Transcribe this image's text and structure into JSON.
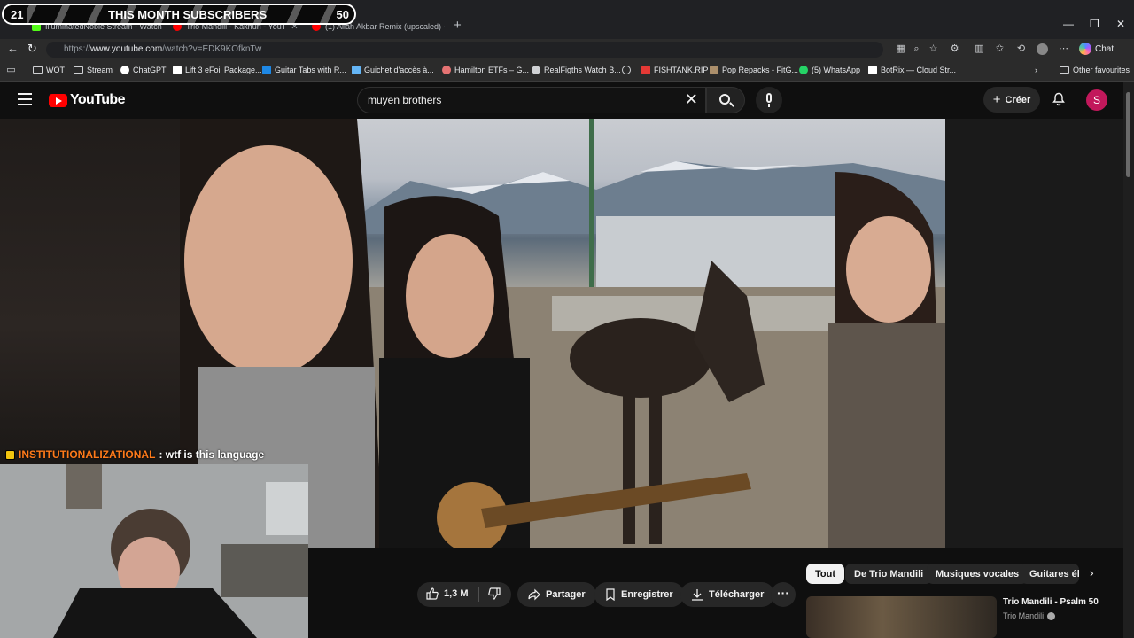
{
  "overlay": {
    "left_count": "21",
    "title": "THIS MONTH SUBSCRIBERS",
    "right_count": "50"
  },
  "tabs": [
    {
      "label": "IlluminatedNoble Stream - Watch",
      "color": "#53fc18"
    },
    {
      "label": "Trio Mandili - Kakhuri - YouT",
      "color": "#ff0000"
    },
    {
      "label": "(1) Allah Akbar Remix (upscaled) -",
      "color": "#ff0000"
    }
  ],
  "browser": {
    "url_prefix": "https://",
    "url_host": "www.youtube.com",
    "url_path": "/watch?v=EDK9KOfknTw",
    "chat_label": "Chat"
  },
  "bookmarks": [
    {
      "label": "WOT",
      "icon": "folder-icon"
    },
    {
      "label": "Stream",
      "icon": "folder-icon"
    },
    {
      "label": "ChatGPT",
      "icon": "chatgpt-icon",
      "color": "#ffffff"
    },
    {
      "label": "Lift 3 eFoil Package...",
      "icon": "lift-icon",
      "color": "#ffffff"
    },
    {
      "label": "Guitar Tabs with R...",
      "icon": "tabs-icon",
      "color": "#1e88e5"
    },
    {
      "label": "Guichet d'accès à...",
      "icon": "guichet-icon",
      "color": "#64b5f6"
    },
    {
      "label": "Hamilton ETFs – G...",
      "icon": "hamilton-icon",
      "color": "#e57373"
    },
    {
      "label": "RealFigths Watch B...",
      "icon": "wordpress-icon",
      "color": "#cfd1d4"
    },
    {
      "label": "",
      "icon": "globe-icon",
      "color": "#cfd1d4"
    },
    {
      "label": "FISHTANK.RIP",
      "icon": "fishtank-icon",
      "color": "#e53935"
    },
    {
      "label": "Pop Repacks - FitG...",
      "icon": "fitgirl-icon",
      "color": "#ab8f6b"
    },
    {
      "label": "(5) WhatsApp",
      "icon": "whatsapp-icon",
      "color": "#25d366"
    },
    {
      "label": "BotRix — Cloud Str...",
      "icon": "botrix-icon",
      "color": "#ffffff"
    }
  ],
  "other_favourites": "Other favourites",
  "youtube": {
    "logo_text": "YouTube",
    "search_query": "muyen brothers",
    "create_label": "Créer",
    "avatar_letter": "S"
  },
  "chat": {
    "user": "INSTITUTIONALIZATIONAL",
    "message": ": wtf is this language"
  },
  "actions": {
    "likes": "1,3 M",
    "share": "Partager",
    "save": "Enregistrer",
    "download": "Télécharger"
  },
  "chips": [
    "Tout",
    "De Trio Mandili",
    "Musiques vocales",
    "Guitares éle"
  ],
  "recommendation": {
    "title": "Trio Mandili - Psalm 50",
    "channel": "Trio Mandili"
  }
}
